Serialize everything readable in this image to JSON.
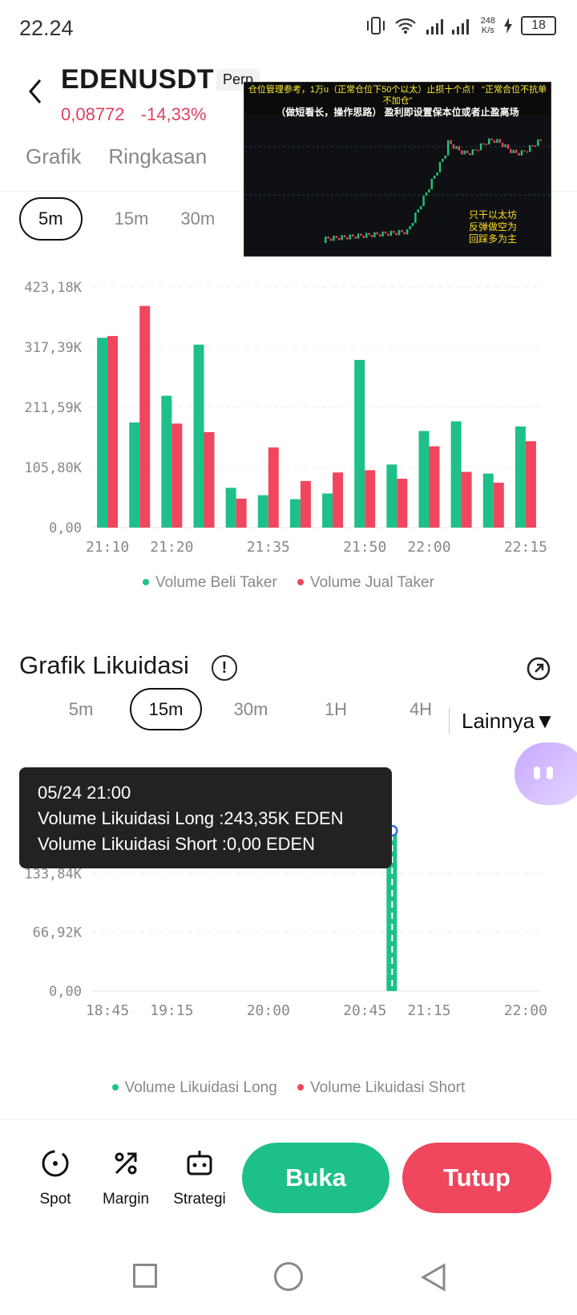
{
  "status": {
    "time": "22.24",
    "net_speed_value": "248",
    "net_speed_unit": "K/s",
    "battery": "18"
  },
  "header": {
    "symbol": "EDENUSDT",
    "badge": "Perp",
    "price": "0,08772",
    "change": "-14,33%"
  },
  "tabs": [
    "Grafik",
    "Ringkasan"
  ],
  "overlay": {
    "banner_line1": "仓位管理参考，1万u（正常仓位下50个以太）止损十个点！ “正常合位不抗单不加仓”",
    "banner_line2": "（做短看长，操作思路） 盈利即设置保本位或者止盈离场",
    "side_text": [
      "只干以太坊",
      "反弹做空为",
      "回踩多为主"
    ]
  },
  "interval_tabs_1": [
    "5m",
    "15m",
    "30m"
  ],
  "interval_tabs_1_active": "5m",
  "taker_legend": {
    "buy": "Volume Beli Taker",
    "sell": "Volume Jual Taker"
  },
  "liq_section": {
    "title": "Grafik Likuidasi",
    "info": "!",
    "more": "Lainnya"
  },
  "interval_tabs_2": [
    "5m",
    "15m",
    "30m",
    "1H",
    "4H"
  ],
  "interval_tabs_2_active": "15m",
  "tooltip": {
    "time": "05/24 21:00",
    "long": "Volume Likuidasi Long :243,35K EDEN",
    "short": "Volume Likuidasi Short :0,00 EDEN"
  },
  "liq_legend": {
    "long": "Volume Likuidasi Long",
    "short": "Volume Likuidasi Short"
  },
  "actions": {
    "spot": "Spot",
    "margin": "Margin",
    "strategy": "Strategi",
    "open": "Buka",
    "close": "Tutup"
  },
  "colors": {
    "green": "#1ec08a",
    "red": "#f0465e",
    "price_red": "#e0415f"
  },
  "chart_data": [
    {
      "type": "bar",
      "title": "",
      "x": [
        "21:10",
        "21:15",
        "21:20",
        "21:25",
        "21:30",
        "21:35",
        "21:40",
        "21:45",
        "21:50",
        "21:55",
        "22:00",
        "22:05",
        "22:10",
        "22:15"
      ],
      "x_tick_labels": [
        "21:10",
        "21:20",
        "21:35",
        "21:50",
        "22:00",
        "22:15"
      ],
      "y_tick_labels": [
        "0,00",
        "105,80K",
        "211,59K",
        "317,39K",
        "423,18K"
      ],
      "ylim": [
        0,
        423180
      ],
      "series": [
        {
          "name": "Volume Beli Taker",
          "color": "#1ec08a",
          "values": [
            334000,
            185000,
            232000,
            322000,
            70000,
            57000,
            50000,
            60000,
            295000,
            111000,
            170000,
            187000,
            95000,
            178000
          ]
        },
        {
          "name": "Volume Jual Taker",
          "color": "#f0465e",
          "values": [
            337000,
            390000,
            183000,
            168000,
            51000,
            141000,
            82000,
            97000,
            101000,
            86000,
            143000,
            98000,
            79000,
            152000
          ]
        }
      ],
      "grid": true,
      "legend": "bottom"
    },
    {
      "type": "bar",
      "title": "Grafik Likuidasi",
      "x": [
        "18:45",
        "19:00",
        "19:15",
        "19:30",
        "19:45",
        "20:00",
        "20:15",
        "20:30",
        "20:45",
        "21:00",
        "21:15",
        "21:30",
        "21:45",
        "22:00"
      ],
      "x_tick_labels": [
        "18:45",
        "19:15",
        "20:00",
        "20:45",
        "21:15",
        "22:00"
      ],
      "y_tick_labels": [
        "0,00",
        "66,92K",
        "133,84K"
      ],
      "ylim": [
        0,
        267680
      ],
      "series": [
        {
          "name": "Volume Likuidasi Long",
          "color": "#1ec08a",
          "values": [
            0,
            0,
            0,
            0,
            0,
            0,
            0,
            0,
            0,
            243350,
            0,
            0,
            0,
            0
          ]
        },
        {
          "name": "Volume Likuidasi Short",
          "color": "#f0465e",
          "values": [
            0,
            0,
            0,
            0,
            0,
            0,
            0,
            0,
            0,
            0,
            0,
            0,
            0,
            0
          ]
        }
      ],
      "grid": true,
      "legend": "bottom",
      "highlight_index": 9
    }
  ]
}
